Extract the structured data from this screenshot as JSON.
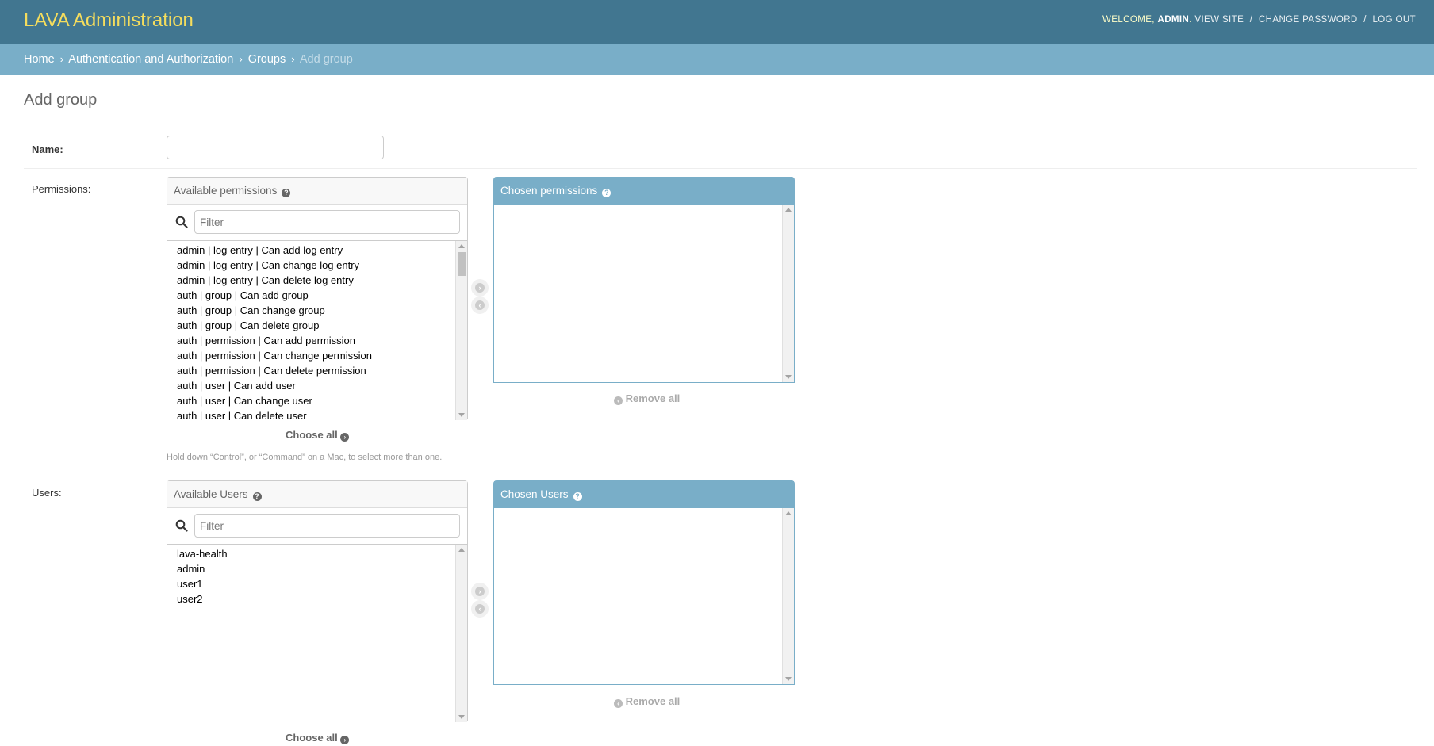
{
  "header": {
    "branding": "LAVA Administration",
    "welcome": "WELCOME,",
    "username": "ADMIN",
    "view_site": "VIEW SITE",
    "change_password": "CHANGE PASSWORD",
    "log_out": "LOG OUT",
    "separator": "/"
  },
  "breadcrumbs": {
    "home": "Home",
    "app": "Authentication and Authorization",
    "model": "Groups",
    "current": "Add group",
    "arrow": "›"
  },
  "page": {
    "title": "Add group"
  },
  "name_row": {
    "label": "Name:",
    "value": ""
  },
  "permissions": {
    "label": "Permissions:",
    "available_title": "Available permissions",
    "chosen_title": "Chosen permissions",
    "filter_placeholder": "Filter",
    "available": [
      "admin | log entry | Can add log entry",
      "admin | log entry | Can change log entry",
      "admin | log entry | Can delete log entry",
      "auth | group | Can add group",
      "auth | group | Can change group",
      "auth | group | Can delete group",
      "auth | permission | Can add permission",
      "auth | permission | Can change permission",
      "auth | permission | Can delete permission",
      "auth | user | Can add user",
      "auth | user | Can change user",
      "auth | user | Can delete user"
    ],
    "chosen": [],
    "choose_all": "Choose all",
    "remove_all": "Remove all",
    "help_text": "Hold down “Control”, or “Command” on a Mac, to select more than one."
  },
  "users": {
    "label": "Users:",
    "available_title": "Available Users",
    "chosen_title": "Chosen Users",
    "filter_placeholder": "Filter",
    "available": [
      "lava-health",
      "admin",
      "user1",
      "user2"
    ],
    "chosen": [],
    "choose_all": "Choose all",
    "remove_all": "Remove all"
  },
  "colors": {
    "header_bg": "#417690",
    "branding": "#f5dd5d",
    "breadcrumbs_bg": "#79aec8",
    "chosen_title_bg": "#79aec8"
  },
  "icons": {
    "help": "?",
    "choose_arrow": "›",
    "remove_arrow": "‹"
  }
}
